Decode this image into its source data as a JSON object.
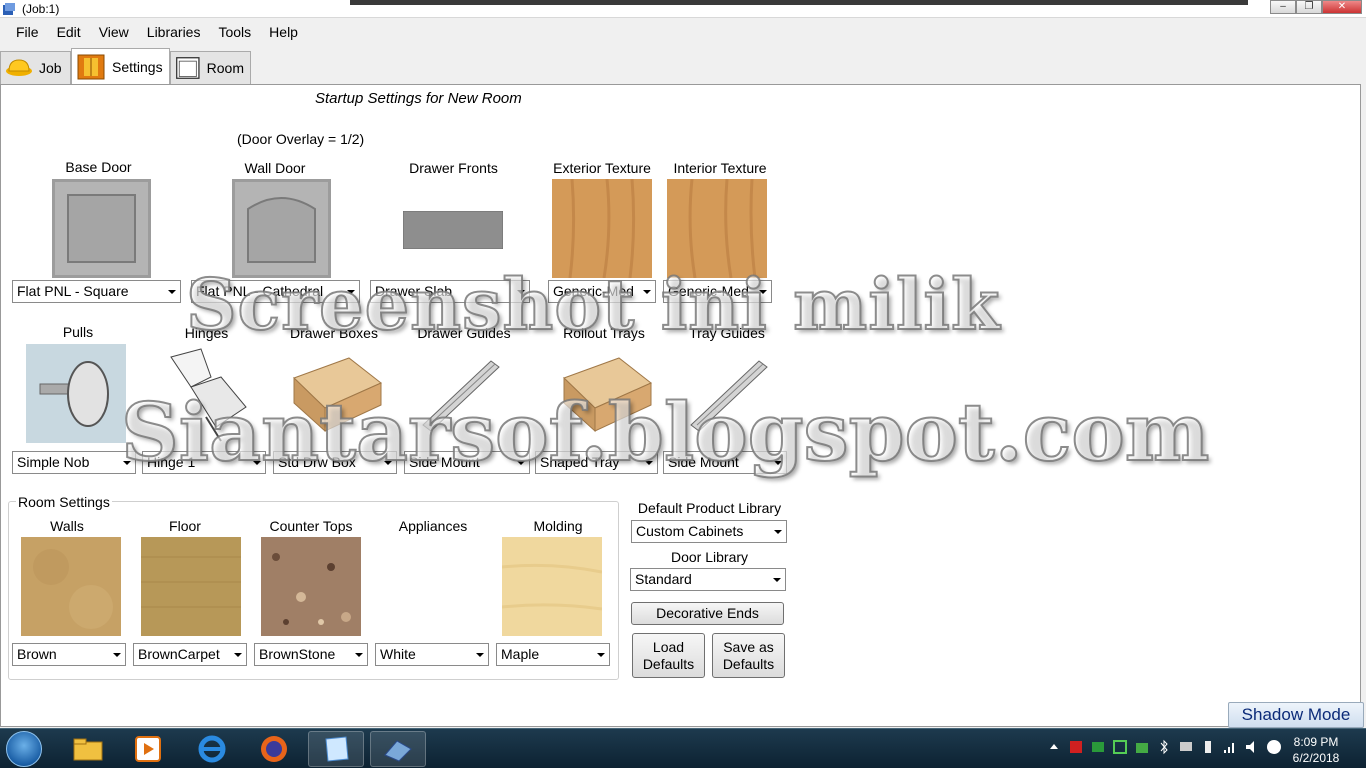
{
  "window": {
    "title": "(Job:1)",
    "controls": {
      "minimize": "–",
      "maximize": "❐",
      "close": "✕"
    }
  },
  "menu": [
    "File",
    "Edit",
    "View",
    "Libraries",
    "Tools",
    "Help"
  ],
  "tabs": [
    {
      "label": "Job",
      "icon": "hardhat-icon",
      "active": false
    },
    {
      "label": "Settings",
      "icon": "settings-book-icon",
      "active": true
    },
    {
      "label": "Room",
      "icon": "room-icon",
      "active": false
    }
  ],
  "main": {
    "heading": "Startup Settings for New Room",
    "door_overlay": "(Door Overlay = 1/2)",
    "row1": [
      {
        "label": "Base Door",
        "value": "Flat PNL - Square",
        "swatch": "#a8a8a8"
      },
      {
        "label": "Wall Door",
        "value": "Flat PNL - Cathedral",
        "swatch": "#a8a8a8"
      },
      {
        "label": "Drawer Fronts",
        "value": "Drawer Slab",
        "swatch": "#9a9a9a"
      },
      {
        "label": "Exterior Texture",
        "value": "Generic-Med",
        "swatch": "#d39a5a"
      },
      {
        "label": "Interior Texture",
        "value": "Generic-Med",
        "swatch": "#d39a5a"
      }
    ],
    "row2": [
      {
        "label": "Pulls",
        "value": "Simple Nob"
      },
      {
        "label": "Hinges",
        "value": "Hinge 1"
      },
      {
        "label": "Drawer Boxes",
        "value": "Std Drw Box"
      },
      {
        "label": "Drawer Guides",
        "value": "Side Mount"
      },
      {
        "label": "Rollout Trays",
        "value": "Shaped Tray"
      },
      {
        "label": "Tray Guides",
        "value": "Side Mount"
      }
    ],
    "room_settings": {
      "title": "Room Settings",
      "items": [
        {
          "label": "Walls",
          "value": "Brown",
          "swatch": "#c8a468"
        },
        {
          "label": "Floor",
          "value": "BrownCarpet",
          "swatch": "#b89a5a"
        },
        {
          "label": "Counter Tops",
          "value": "BrownStone",
          "swatch": "#a08068"
        },
        {
          "label": "Appliances",
          "value": "White",
          "swatch": "#ffffff"
        },
        {
          "label": "Molding",
          "value": "Maple",
          "swatch": "#f0d8a0"
        }
      ]
    },
    "library": {
      "product_label": "Default Product Library",
      "product_value": "Custom Cabinets",
      "door_label": "Door Library",
      "door_value": "Standard"
    },
    "buttons": {
      "decorative_ends": "Decorative Ends",
      "load_defaults": "Load Defaults",
      "save_defaults": "Save as Defaults"
    },
    "watermark": {
      "line1": "Screenshot ini  milik",
      "line2": "Siantarsof.blogspot.com"
    }
  },
  "shadow_mode": "Shadow Mode",
  "taskbar": {
    "time": "8:09 PM",
    "date": "6/2/2018",
    "apps": [
      "start-orb",
      "file-explorer-icon",
      "media-player-icon",
      "internet-explorer-icon",
      "firefox-icon",
      "notes-app-icon",
      "cabinet-app-icon"
    ]
  }
}
